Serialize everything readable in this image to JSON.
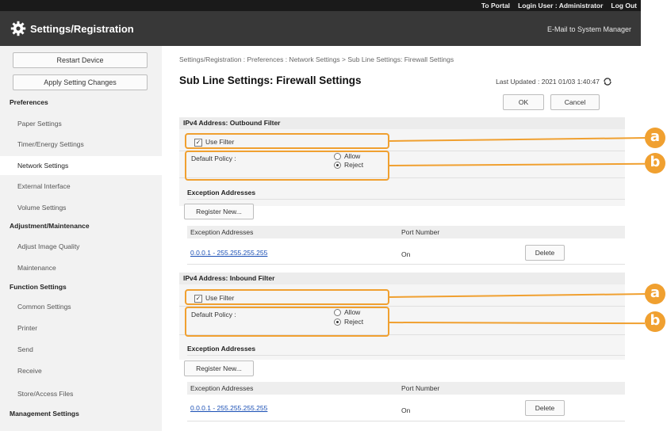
{
  "topbar": {
    "portal": "To Portal",
    "login_user": "Login User : Administrator",
    "logout": "Log Out"
  },
  "header": {
    "title": "Settings/Registration",
    "mail": "E-Mail to System Manager"
  },
  "sidebar": {
    "restart": "Restart Device",
    "apply": "Apply Setting Changes",
    "sections": [
      {
        "label": "Preferences",
        "items": [
          "Paper Settings",
          "Timer/Energy Settings",
          "Network Settings",
          "External Interface",
          "Volume Settings"
        ]
      },
      {
        "label": "Adjustment/Maintenance",
        "items": [
          "Adjust Image Quality",
          "Maintenance"
        ]
      },
      {
        "label": "Function Settings",
        "items": [
          "Common Settings",
          "Printer",
          "Send",
          "Receive",
          "Store/Access Files"
        ]
      },
      {
        "label": "Management Settings",
        "items": []
      }
    ]
  },
  "main": {
    "breadcrumb": "Settings/Registration : Preferences : Network Settings > Sub Line Settings: Firewall Settings",
    "title": "Sub Line Settings: Firewall Settings",
    "last_updated": "Last Updated : 2021 01/03 1:40:47",
    "ok": "OK",
    "cancel": "Cancel",
    "filters": [
      {
        "header": "IPv4 Address: Outbound Filter",
        "use_filter": "Use Filter",
        "default_policy": "Default Policy :",
        "allow": "Allow",
        "reject": "Reject",
        "exceptions_title": "Exception Addresses",
        "register": "Register New...",
        "col_addresses": "Exception Addresses",
        "col_port": "Port Number",
        "row_address": "0.0.0.1 - 255.255.255.255",
        "row_port": "On",
        "delete": "Delete"
      },
      {
        "header": "IPv4 Address: Inbound Filter",
        "use_filter": "Use Filter",
        "default_policy": "Default Policy :",
        "allow": "Allow",
        "reject": "Reject",
        "exceptions_title": "Exception Addresses",
        "register": "Register New...",
        "col_addresses": "Exception Addresses",
        "col_port": "Port Number",
        "row_address": "0.0.0.1 - 255.255.255.255",
        "row_port": "On",
        "delete": "Delete"
      }
    ]
  },
  "callouts": {
    "a": "a",
    "b": "b"
  },
  "colors": {
    "accent": "#f0a030",
    "header_bg": "#383838",
    "link": "#1a4fb5"
  }
}
